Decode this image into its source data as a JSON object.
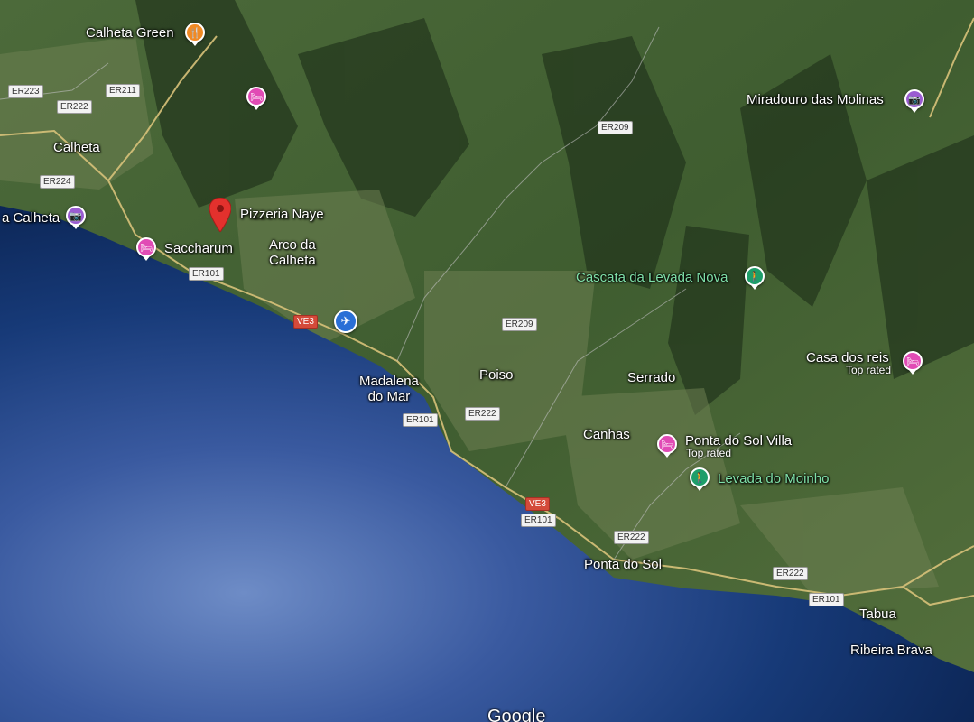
{
  "map": {
    "colors": {
      "sea_deep": "#0e2a5c",
      "sea_light": "#5d7dbd",
      "land": "#3d5a2e",
      "road": "#d8c27a",
      "lodging_pin": "#e14bb5",
      "poi_pin": "#9a5cd1",
      "restaurant_pin": "#f08a24",
      "hiking_pin": "#1e9e6a",
      "airport_pin": "#2a6fd6",
      "location_pin": "#e3312d"
    },
    "towns": {
      "calheta": "Calheta",
      "arco_line1": "Arco da",
      "arco_line2": "Calheta",
      "madalena_line1": "Madalena",
      "madalena_line2": "do Mar",
      "poiso": "Poiso",
      "serrado": "Serrado",
      "canhas": "Canhas",
      "ponta_do_sol": "Ponta do Sol",
      "tabua": "Tabua",
      "ribeira_brava": "Ribeira Brava"
    },
    "pois": {
      "calheta_green": "Calheta Green",
      "miradouro": "Miradouro das Molinas",
      "praia_calheta": "a Calheta",
      "pizzeria": "Pizzeria Naye",
      "saccharum": "Saccharum",
      "cascata": "Cascata da Levada Nova",
      "casa_dos_reis": "Casa dos reis",
      "casa_dos_reis_sub": "Top rated",
      "ponta_villa": "Ponta do Sol Villa",
      "ponta_villa_sub": "Top rated",
      "levada_moinho": "Levada do Moinho"
    },
    "roads": {
      "er223": "ER223",
      "er211": "ER211",
      "er222_a": "ER222",
      "er224": "ER224",
      "er209_a": "ER209",
      "er101_a": "ER101",
      "ve3_a": "VE3",
      "er209_b": "ER209",
      "er101_b": "ER101",
      "er222_b": "ER222",
      "ve3_b": "VE3",
      "er101_c": "ER101",
      "er222_c": "ER222",
      "er222_d": "ER222",
      "er101_d": "ER101"
    },
    "icons": {
      "restaurant": "restaurant-icon",
      "lodging": "hotel-icon",
      "viewpoint": "camera-icon",
      "hiking": "hiking-icon",
      "airport": "airplane-icon",
      "location": "location-pin-icon"
    },
    "watermark": "Google"
  }
}
